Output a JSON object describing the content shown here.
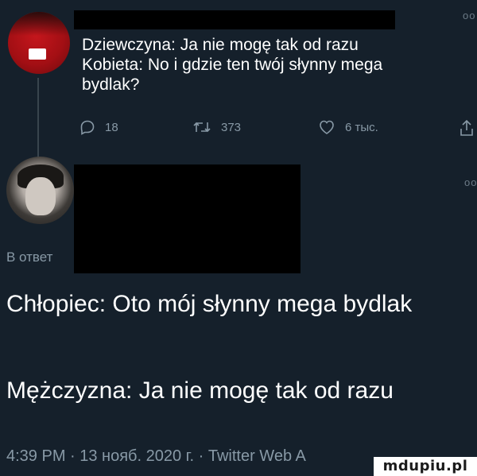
{
  "tweet": {
    "lines": [
      "Dziewczyna: Ja nie mogę tak od razu",
      "Kobieta: No i gdzie ten twój słynny mega",
      "bydlak?"
    ],
    "actions": {
      "replies": "18",
      "retweets": "373",
      "likes": "6 тыс."
    },
    "more_label": "oo"
  },
  "reply": {
    "label": "В ответ",
    "more_label": "oo"
  },
  "main": {
    "line1": "Chłopiec: Oto mój słynny mega bydlak",
    "line2": "Mężczyzna: Ja nie mogę tak od razu"
  },
  "footer": {
    "text": "4:39 PM · 13 нояб. 2020 г. · Twitter Web A"
  },
  "watermark": {
    "text": "mdupiu.pl"
  },
  "colors": {
    "background": "#15202b",
    "muted": "#8899a6",
    "text": "#ffffff"
  }
}
